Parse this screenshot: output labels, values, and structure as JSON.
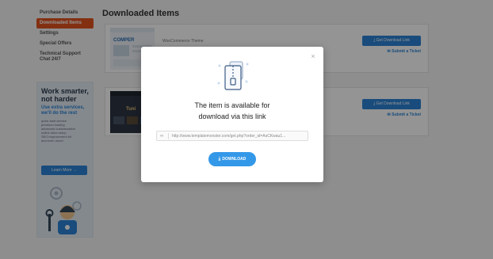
{
  "sidebar": {
    "items": [
      {
        "label": "Purchase Details"
      },
      {
        "label": "Downloaded Items"
      },
      {
        "label": "Settings"
      },
      {
        "label": "Special Offers"
      },
      {
        "label": "Technical Support Chat 24/7"
      }
    ],
    "promo": {
      "title": "Work smarter, not harder",
      "subtitle": "Use extra services, we'll do the rest",
      "services": [
        "quick start service",
        "premium hosting",
        "advanced customization",
        "online store setup",
        "SEO improvement kit",
        "and even more!"
      ],
      "learn_more": "Learn More →"
    }
  },
  "main": {
    "title": "Downloaded Items",
    "items": [
      {
        "name": "WooCommerce Theme",
        "thumb_label": "COMPER",
        "download_label": "Get Download Link",
        "ticket_label": "Submit a Ticket"
      },
      {
        "name": "",
        "thumb_label": "Tuni",
        "download_label": "Get Download Link",
        "ticket_label": "Submit a Ticket"
      }
    ]
  },
  "modal": {
    "headline_line1": "The item is available for",
    "headline_line2": "download via this link",
    "url": "http://www.templatemonster.com/get.php?order_id=AsCKwau1...",
    "download_label": "DOWNLOAD",
    "close_glyph": "×"
  },
  "colors": {
    "accent": "#e2541f",
    "primary": "#2b84d6",
    "download_button": "#3498e8"
  }
}
